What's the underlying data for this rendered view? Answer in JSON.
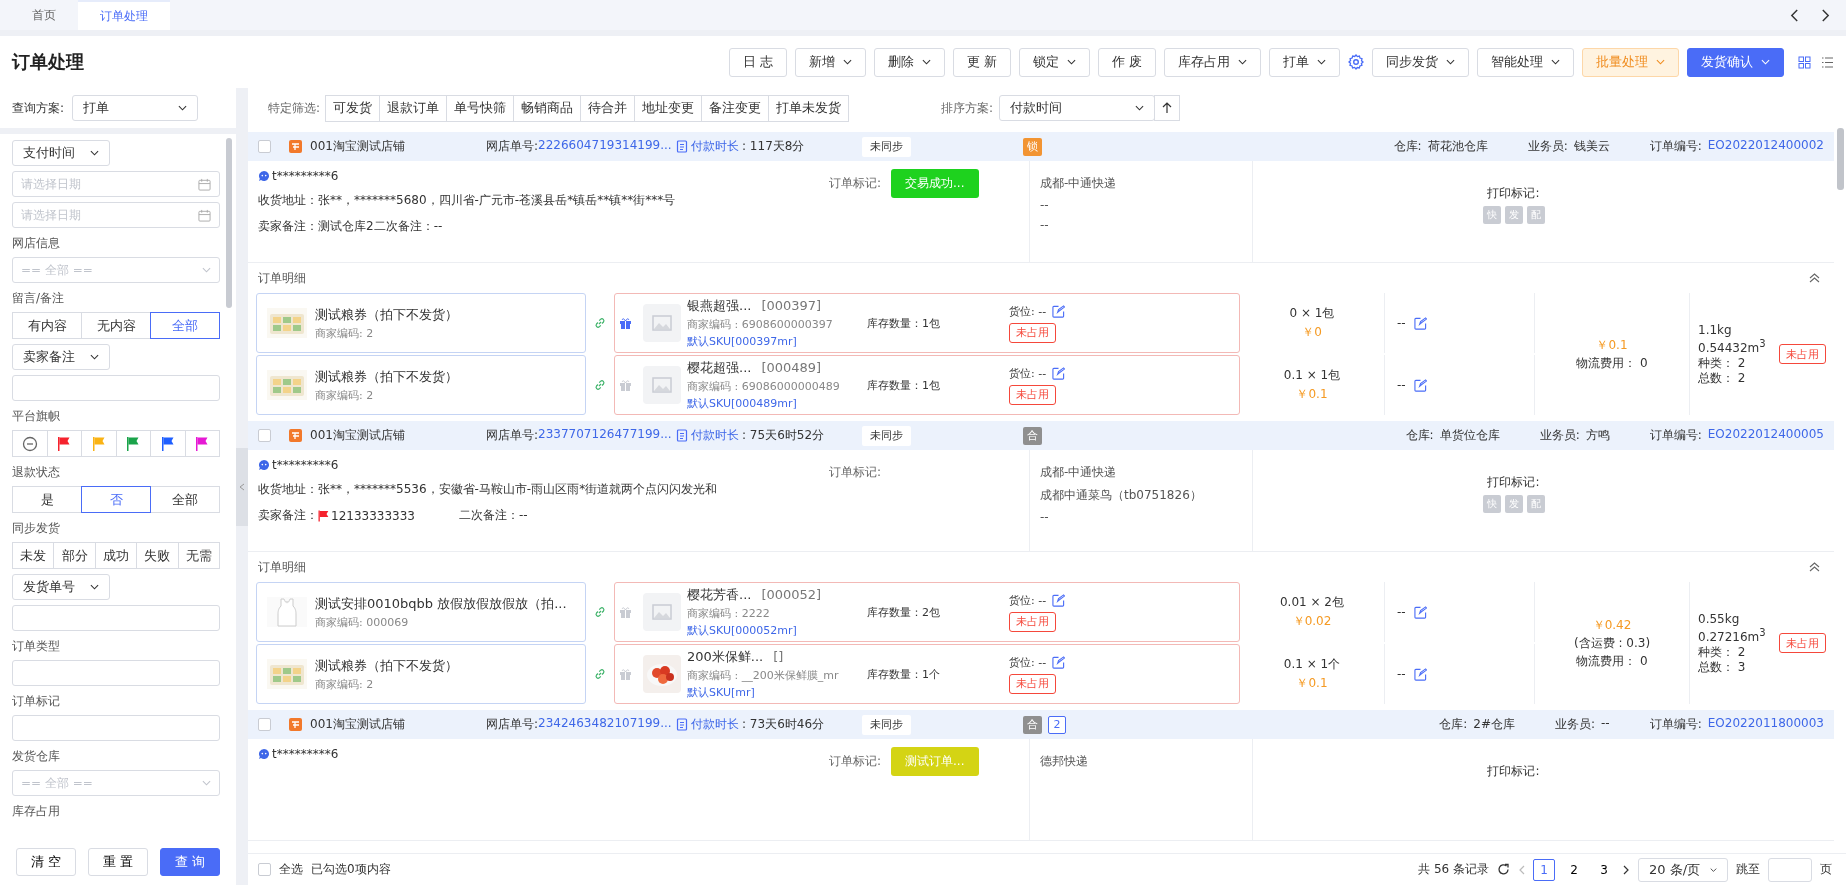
{
  "tabs": [
    {
      "label": "首页",
      "selected": false
    },
    {
      "label": "订单处理",
      "selected": true
    }
  ],
  "page_title": "订单处理",
  "toolbar": [
    {
      "label": "日 志",
      "kind": "default",
      "dropdown": false
    },
    {
      "label": "新增",
      "kind": "default",
      "dropdown": true
    },
    {
      "label": "删除",
      "kind": "default",
      "dropdown": true
    },
    {
      "label": "更 新",
      "kind": "default",
      "dropdown": false
    },
    {
      "label": "锁定",
      "kind": "default",
      "dropdown": true
    },
    {
      "label": "作 废",
      "kind": "default",
      "dropdown": false
    },
    {
      "label": "库存占用",
      "kind": "default",
      "dropdown": true
    },
    {
      "label": "打单",
      "kind": "default",
      "dropdown": true
    },
    {
      "kind": "settings"
    },
    {
      "label": "同步发货",
      "kind": "default",
      "dropdown": true
    },
    {
      "label": "智能处理",
      "kind": "default",
      "dropdown": true
    },
    {
      "label": "批量处理",
      "kind": "warning",
      "dropdown": true
    },
    {
      "label": "发货确认",
      "kind": "primary",
      "dropdown": true
    }
  ],
  "sidebar": {
    "scheme": {
      "label": "查询方案:",
      "value": "打单"
    },
    "filters": [
      {
        "kind": "select",
        "value": "支付时间"
      },
      {
        "kind": "date",
        "placeholder": "请选择日期"
      },
      {
        "kind": "date",
        "placeholder": "请选择日期"
      },
      {
        "kind": "label",
        "text": "网店信息"
      },
      {
        "kind": "combo",
        "placeholder": "== 全部 =="
      },
      {
        "kind": "label",
        "text": "留言/备注"
      },
      {
        "kind": "segmented",
        "options": [
          {
            "label": "有内容",
            "selected": false
          },
          {
            "label": "无内容",
            "selected": false
          },
          {
            "label": "全部",
            "selected": true
          }
        ]
      },
      {
        "kind": "select",
        "value": "卖家备注"
      },
      {
        "kind": "input"
      },
      {
        "kind": "label",
        "text": "平台旗帜"
      },
      {
        "kind": "flags",
        "options": [
          {
            "kind": "none",
            "selected": false
          },
          {
            "kind": "flag",
            "color": "#f5222d",
            "selected": false
          },
          {
            "kind": "flag",
            "color": "#fab314",
            "selected": false
          },
          {
            "kind": "flag",
            "color": "#1aa34a",
            "selected": false
          },
          {
            "kind": "flag",
            "color": "#1f5fff",
            "selected": false
          },
          {
            "kind": "flag",
            "color": "#e619d4",
            "selected": false
          }
        ]
      },
      {
        "kind": "label",
        "text": "退款状态"
      },
      {
        "kind": "segmented",
        "options": [
          {
            "label": "是",
            "selected": false
          },
          {
            "label": "否",
            "selected": true
          },
          {
            "label": "全部",
            "selected": false
          }
        ]
      },
      {
        "kind": "label",
        "text": "同步发货"
      },
      {
        "kind": "segmented",
        "options": [
          {
            "label": "未发",
            "selected": false
          },
          {
            "label": "部分",
            "selected": false
          },
          {
            "label": "成功",
            "selected": false
          },
          {
            "label": "失败",
            "selected": false
          },
          {
            "label": "无需",
            "selected": false
          }
        ]
      },
      {
        "kind": "select",
        "value": "发货单号"
      },
      {
        "kind": "input"
      },
      {
        "kind": "label",
        "text": "订单类型"
      },
      {
        "kind": "input"
      },
      {
        "kind": "label",
        "text": "订单标记"
      },
      {
        "kind": "input"
      },
      {
        "kind": "label",
        "text": "发货仓库"
      },
      {
        "kind": "combo",
        "placeholder": "== 全部 =="
      },
      {
        "kind": "label",
        "text": "库存占用"
      }
    ],
    "buttons": [
      {
        "label": "清 空",
        "kind": "default"
      },
      {
        "label": "重 置",
        "kind": "default"
      },
      {
        "label": "查 询",
        "kind": "primary"
      }
    ]
  },
  "filter_bar": {
    "label": "特定筛选:",
    "chips": [
      "可发货",
      "退款订单",
      "单号快筛",
      "畅销商品",
      "待合并",
      "地址变更",
      "备注变更",
      "打单未发货"
    ],
    "sort_label": "排序方案:",
    "sort_value": "付款时间"
  },
  "orders": [
    {
      "checked": false,
      "shop": "001淘宝测试店铺",
      "shop_order": {
        "label": "网店单号:",
        "value": "2226604719314199..."
      },
      "pay": {
        "label": "付款时长",
        "value": ": 117天8分"
      },
      "sync": "未同步",
      "tags": [
        {
          "kind": "lock",
          "text": "锁"
        }
      ],
      "fields": [
        {
          "label": "仓库:",
          "value": "荷花池仓库",
          "link": false
        },
        {
          "label": "业务员:",
          "value": "钱美云",
          "link": false
        },
        {
          "label": "订单编号:",
          "value": "EO2022012400002",
          "link": true
        }
      ],
      "buyer": "t*********6",
      "address": "收货地址：张**，*******5680，四川省-广元市-苍溪县岳*镇岳**镇**街***号",
      "remarks": [
        {
          "text": "卖家备注：测试仓库2二次备注：--"
        }
      ],
      "mark": {
        "label": "订单标记:",
        "value": "交易成功...",
        "color": "#1ed21e"
      },
      "logistics": [
        "成都-中通快递",
        "--",
        "--"
      ],
      "print": {
        "label": "打印标记:",
        "chips": [
          "快",
          "发",
          "配"
        ]
      },
      "detail_title": "订单明细",
      "items": [
        {
          "source": {
            "kind": "coupon",
            "name": "测试粮券（拍下不发货）",
            "code": "商家编码: 2"
          },
          "product": {
            "gift": true,
            "kind": "placeholder",
            "name": "银燕超强...",
            "sku_code": "[000397]",
            "merchant_code": "商家编码 : 6908600000397",
            "stock": "库存数量：1包",
            "sku": "默认SKU[000397mr]",
            "location": "货位: --",
            "status": "未占用"
          },
          "quantity": "0 × 1包",
          "price": "￥0",
          "remark": "--"
        },
        {
          "source": {
            "kind": "coupon",
            "name": "测试粮券（拍下不发货）",
            "code": "商家编码: 2"
          },
          "product": {
            "gift": false,
            "kind": "placeholder",
            "name": "樱花超强...",
            "sku_code": "[000489]",
            "merchant_code": "商家编码 : 69086000000489",
            "stock": "库存数量：1包",
            "sku": "默认SKU[000489mr]",
            "location": "货位: --",
            "status": "未占用"
          },
          "quantity": "0.1 × 1包",
          "price": "￥0.1",
          "remark": "--"
        }
      ],
      "summary": {
        "amount": "￥0.1",
        "fee_label": "物流费用：",
        "fee": "0",
        "weight": "1.1kg",
        "volume": "0.54432m$^{3}$",
        "kinds": "种类： 2",
        "total": "总数： 2",
        "status": "未占用"
      }
    },
    {
      "checked": false,
      "shop": "001淘宝测试店铺",
      "shop_order": {
        "label": "网店单号:",
        "value": "2337707126477199..."
      },
      "pay": {
        "label": "付款时长",
        "value": ": 75天6时52分"
      },
      "sync": "未同步",
      "tags": [
        {
          "kind": "merge",
          "text": "合"
        }
      ],
      "fields": [
        {
          "label": "仓库:",
          "value": "单货位仓库",
          "link": false
        },
        {
          "label": "业务员:",
          "value": "方鸣",
          "link": false
        },
        {
          "label": "订单编号:",
          "value": "EO2022012400005",
          "link": true
        }
      ],
      "buyer": "t*********6",
      "address": "收货地址：张**，*******5536，安徽省-马鞍山市-雨山区雨*街道就两个点闪闪发光和",
      "remarks": [
        {
          "text": "卖家备注："
        },
        {
          "text": "12133333333",
          "color": "#f5222d"
        },
        {
          "text": "二次备注：--"
        }
      ],
      "mark": {
        "label": "订单标记:"
      },
      "logistics": [
        "成都-中通快递",
        "成都中通菜鸟（tb0751826）",
        "--"
      ],
      "print": {
        "label": "打印标记:",
        "chips": [
          "快",
          "发",
          "配"
        ]
      },
      "detail_title": "订单明细",
      "items": [
        {
          "source": {
            "kind": "singlet",
            "name": "测试安排0010bqbb 放假放假放假放（拍...",
            "code": "商家编码: 000069"
          },
          "product": {
            "gift": false,
            "kind": "placeholder",
            "name": "樱花芳香...",
            "sku_code": "[000052]",
            "merchant_code": "商家编码 : 2222",
            "stock": "库存数量：2包",
            "sku": "默认SKU[000052mr]",
            "location": "货位: --",
            "status": "未占用"
          },
          "quantity": "0.01 × 2包",
          "price": "￥0.02",
          "remark": "--"
        },
        {
          "source": {
            "kind": "coupon",
            "name": "测试粮券（拍下不发货）",
            "code": "商家编码: 2"
          },
          "product": {
            "gift": false,
            "kind": "picture",
            "name": "200米保鲜...",
            "sku_code": "[]",
            "merchant_code": "商家编码 : __200米保鲜膜_mr",
            "stock": "库存数量：1个",
            "sku": "默认SKU[mr]",
            "location": "货位: --",
            "status": "未占用"
          },
          "quantity": "0.1 × 1个",
          "price": "￥0.1",
          "remark": "--"
        }
      ],
      "summary": {
        "amount": "￥0.42",
        "freight": "(含运费 : 0.3)",
        "fee_label": "物流费用：",
        "fee": "0",
        "weight": "0.55kg",
        "volume": "0.27216m$^{3}$",
        "kinds": "种类： 2",
        "total": "总数： 3",
        "status": "未占用"
      }
    },
    {
      "checked": false,
      "shop": "001淘宝测试店铺",
      "shop_order": {
        "label": "网店单号:",
        "value": "2342463482107199..."
      },
      "pay": {
        "label": "付款时长",
        "value": ": 73天6时46分"
      },
      "sync": "未同步",
      "tags": [
        {
          "kind": "merge",
          "text": "合"
        },
        {
          "kind": "count",
          "text": "2"
        }
      ],
      "fields": [
        {
          "label": "仓库:",
          "value": "2#仓库",
          "link": false
        },
        {
          "label": "业务员:",
          "value": "--",
          "link": false
        },
        {
          "label": "订单编号:",
          "value": "EO2022011800003",
          "link": true
        }
      ],
      "buyer": "t*********6",
      "mark": {
        "label": "订单标记:",
        "value": "测试订单...",
        "color": "#d4d414"
      },
      "logistics": [
        "德邦快递"
      ],
      "print": {
        "label": "打印标记:"
      }
    }
  ],
  "footer": {
    "select_all": {
      "label": "全选",
      "checked": false
    },
    "selected_text": "已勾选0项内容",
    "total": "共 56 条记录",
    "pages": [
      {
        "label": "1",
        "selected": true
      },
      {
        "label": "2",
        "selected": false
      },
      {
        "label": "3",
        "selected": false
      }
    ],
    "page_size": "20 条/页",
    "jump_label": "跳至",
    "page_unit": "页"
  }
}
